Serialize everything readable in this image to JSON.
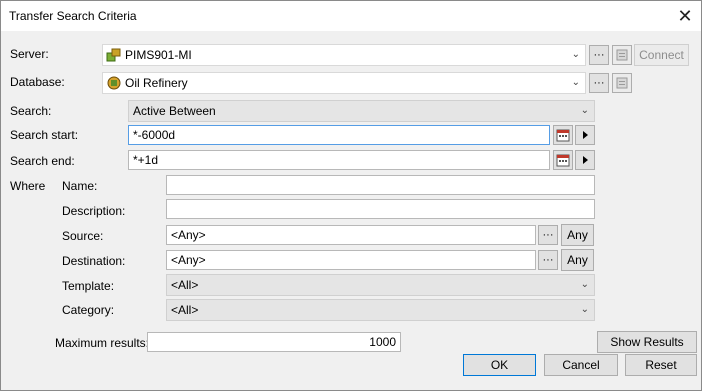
{
  "window": {
    "title": "Transfer Search Criteria"
  },
  "labels": {
    "server": "Server:",
    "database": "Database:",
    "search": "Search:",
    "search_start": "Search start:",
    "search_end": "Search end:",
    "where": "Where",
    "name": "Name:",
    "description": "Description:",
    "source": "Source:",
    "destination": "Destination:",
    "template": "Template:",
    "category": "Category:",
    "maximum_results": "Maximum results:"
  },
  "fields": {
    "server": "PIMS901-MI",
    "database": "Oil Refinery",
    "search": "Active Between",
    "search_start": "*-6000d",
    "search_end": "*+1d",
    "name": "",
    "description": "",
    "source": "<Any>",
    "destination": "<Any>",
    "template": "<All>",
    "category": "<All>",
    "maximum_results": "1000"
  },
  "buttons": {
    "ellipsis": "···",
    "connect": "Connect",
    "any": "Any",
    "show_results": "Show Results",
    "ok": "OK",
    "cancel": "Cancel",
    "reset": "Reset"
  },
  "icons": {
    "server": "server-icon",
    "database": "database-icon",
    "properties": "properties-icon",
    "calendar": "calendar-icon",
    "play": "play-icon",
    "close": "close-icon"
  }
}
